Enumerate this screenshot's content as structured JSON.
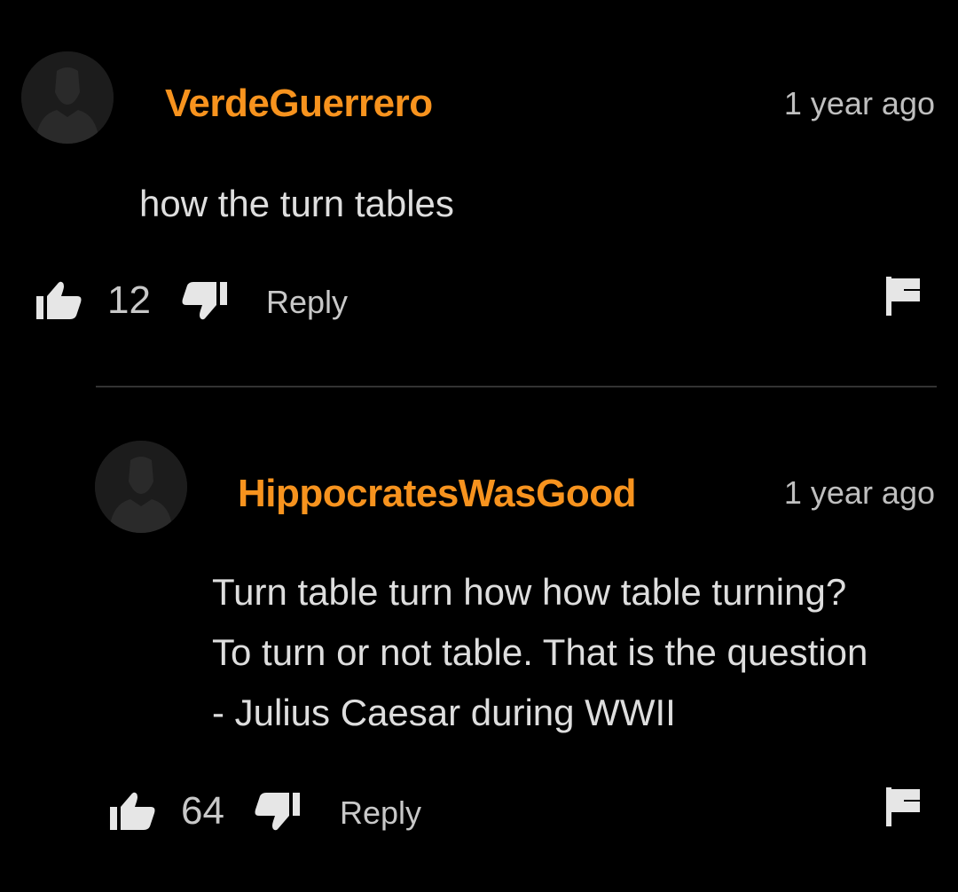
{
  "colors": {
    "background": "#000000",
    "username": "#f7931e",
    "text": "#dedede",
    "muted": "#c8c8c8",
    "avatar_bg": "#1c1c1c",
    "divider": "#333333"
  },
  "comments": [
    {
      "username": "VerdeGuerrero",
      "timestamp": "1 year ago",
      "body": [
        "how the turn tables"
      ],
      "likes": "12",
      "reply_label": "Reply",
      "avatar_icon": "default-avatar-icon",
      "like_icon": "thumbs-up-icon",
      "dislike_icon": "thumbs-down-icon",
      "flag_icon": "flag-icon"
    },
    {
      "username": "HippocratesWasGood",
      "timestamp": "1 year ago",
      "body": [
        "Turn table turn how how table turning?",
        "To turn or not table. That is the question",
        "- Julius Caesar during WWII"
      ],
      "likes": "64",
      "reply_label": "Reply",
      "avatar_icon": "default-avatar-icon",
      "like_icon": "thumbs-up-icon",
      "dislike_icon": "thumbs-down-icon",
      "flag_icon": "flag-icon"
    }
  ]
}
